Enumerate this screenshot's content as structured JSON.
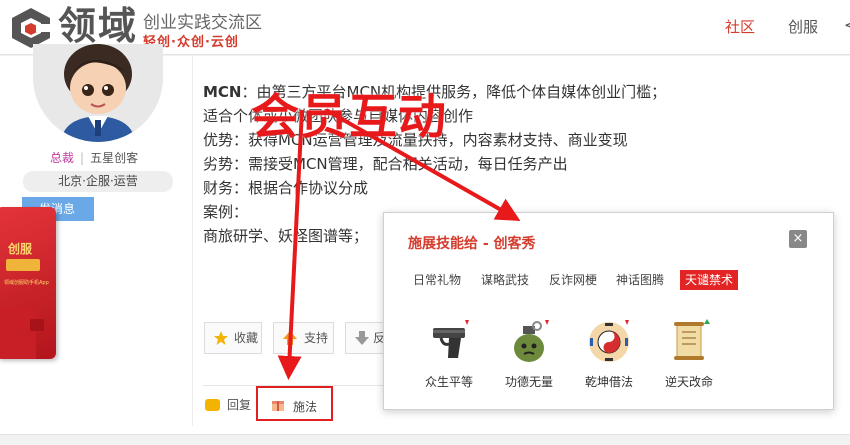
{
  "header": {
    "logo_name": "领域",
    "logo_sub1": "创业实践交流区",
    "logo_sub2": "轻创·众创·云创",
    "nav": [
      "社区",
      "创服",
      "<"
    ]
  },
  "profile": {
    "role_admin": "总裁",
    "role_sep": "|",
    "role_level": "五星创客",
    "location": "北京·企服·运营",
    "message_button": "发消息"
  },
  "redbook": {
    "title": "创服",
    "subtitle": "领域创服助手机App"
  },
  "post": {
    "line1_bold": "MCN",
    "line1_rest": "：由第三方平台MCN机构提供服务，降低个体自媒体创业门槛；",
    "line2": "适合个体或小微团队参与自媒体内容创作",
    "line3": "优势：获得MCN运营管理及流量扶持，内容素材支持、商业变现",
    "line4": "劣势：需接受MCN管理，配合相关活动，每日任务产出",
    "line5": "财务：根据合作协议分成",
    "line6": "案例：",
    "line7": "商旅研学、妖怪图谱等；"
  },
  "actions": {
    "favorite": "收藏",
    "support": "支持",
    "oppose": "反"
  },
  "bottom": {
    "reply": "回复",
    "cast": "施法"
  },
  "popup": {
    "title": "施展技能给 - 创客秀",
    "close": "×",
    "tabs": [
      "日常礼物",
      "谋略武技",
      "反诈网梗",
      "神话图腾",
      "天谴禁术"
    ],
    "active_tab": "天谴禁术",
    "skills": [
      {
        "name": "众生平等",
        "icon": "pistol-icon"
      },
      {
        "name": "功德无量",
        "icon": "grenade-icon"
      },
      {
        "name": "乾坤借法",
        "icon": "bagua-icon"
      },
      {
        "name": "逆天改命",
        "icon": "scroll-icon"
      }
    ]
  },
  "annotation": {
    "text": "会员互动"
  },
  "colors": {
    "brand_red": "#d43c2e",
    "annotation_red": "#e8191b",
    "message_blue": "#6aa8e8"
  }
}
